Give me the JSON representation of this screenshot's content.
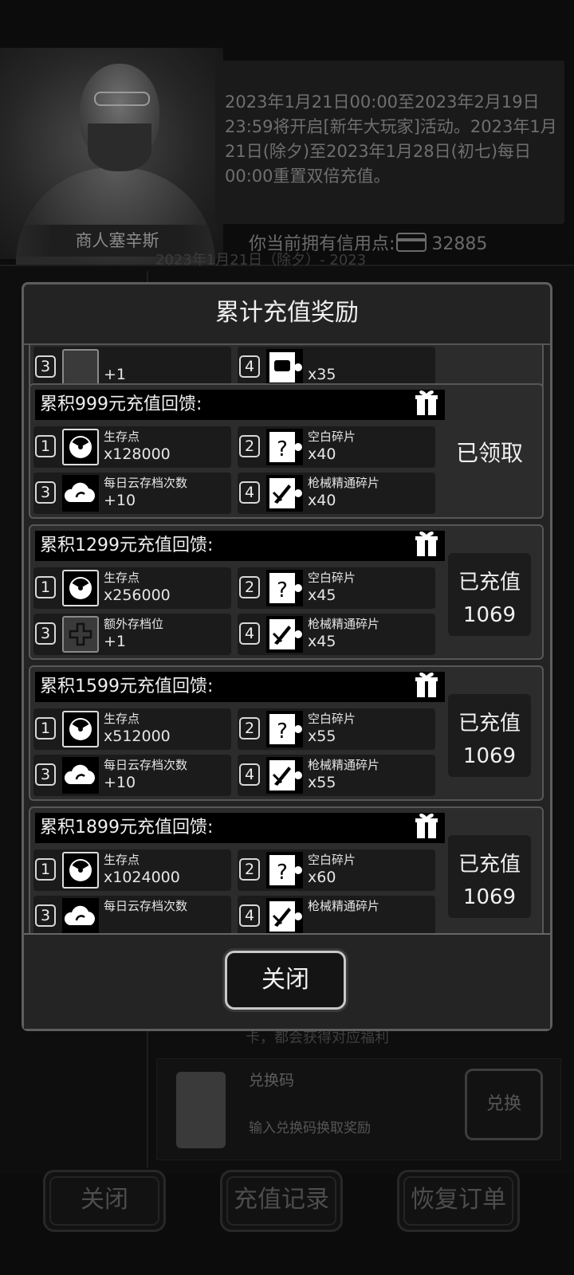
{
  "background": {
    "merchant_name": "商人塞辛斯",
    "announcement": "2023年1月21日00:00至2023年2月19日23:59将开启[新年大玩家]活动。2023年1月21日(除夕)至2023年1月28日(初七)每日00:00重置双倍充值。",
    "credits_label": "你当前拥有信用点:",
    "credits_value": "32885",
    "peek_row_text": "2023年1月21日（除夕）- 2023",
    "peek_card_text": "卡，都会获得对应福利",
    "redeem_code": {
      "title": "兑换码",
      "description": "输入兑换码换取奖励",
      "button": "兑换"
    },
    "bottom_buttons": {
      "close": "关闭",
      "records": "充值记录",
      "restore": "恢复订单"
    }
  },
  "dialog": {
    "title": "累计充值奖励",
    "close_button": "关闭",
    "partial_tier": {
      "items": [
        {
          "num": "3",
          "qty": "+1",
          "icon": "plus-slot-icon"
        },
        {
          "num": "4",
          "qty": "x35",
          "icon": "shield-fragment-icon"
        }
      ]
    },
    "tiers": [
      {
        "title": "累积999元充值回馈:",
        "status_type": "claimed",
        "status_line1": "已领取",
        "status_line2": "",
        "items": [
          {
            "num": "1",
            "name": "生存点",
            "qty": "x128000",
            "icon": "radiation-icon"
          },
          {
            "num": "2",
            "name": "空白碎片",
            "qty": "x40",
            "icon": "puzzle-question-icon"
          },
          {
            "num": "3",
            "name": "每日云存档次数",
            "qty": "+10",
            "icon": "cloud-sync-icon"
          },
          {
            "num": "4",
            "name": "枪械精通碎片",
            "qty": "x40",
            "icon": "gun-fragment-icon"
          }
        ]
      },
      {
        "title": "累积1299元充值回馈:",
        "status_type": "progress",
        "status_line1": "已充值",
        "status_line2": "1069",
        "items": [
          {
            "num": "1",
            "name": "生存点",
            "qty": "x256000",
            "icon": "radiation-icon"
          },
          {
            "num": "2",
            "name": "空白碎片",
            "qty": "x45",
            "icon": "puzzle-question-icon"
          },
          {
            "num": "3",
            "name": "额外存档位",
            "qty": "+1",
            "icon": "plus-slot-icon"
          },
          {
            "num": "4",
            "name": "枪械精通碎片",
            "qty": "x45",
            "icon": "gun-fragment-icon"
          }
        ]
      },
      {
        "title": "累积1599元充值回馈:",
        "status_type": "progress",
        "status_line1": "已充值",
        "status_line2": "1069",
        "items": [
          {
            "num": "1",
            "name": "生存点",
            "qty": "x512000",
            "icon": "radiation-icon"
          },
          {
            "num": "2",
            "name": "空白碎片",
            "qty": "x55",
            "icon": "puzzle-question-icon"
          },
          {
            "num": "3",
            "name": "每日云存档次数",
            "qty": "+10",
            "icon": "cloud-sync-icon"
          },
          {
            "num": "4",
            "name": "枪械精通碎片",
            "qty": "x55",
            "icon": "gun-fragment-icon"
          }
        ]
      },
      {
        "title": "累积1899元充值回馈:",
        "status_type": "progress",
        "status_line1": "已充值",
        "status_line2": "1069",
        "items": [
          {
            "num": "1",
            "name": "生存点",
            "qty": "x1024000",
            "icon": "radiation-icon"
          },
          {
            "num": "2",
            "name": "空白碎片",
            "qty": "x60",
            "icon": "puzzle-question-icon"
          },
          {
            "num": "3",
            "name": "每日云存档次数",
            "qty": "",
            "icon": "cloud-sync-icon"
          },
          {
            "num": "4",
            "name": "枪械精通碎片",
            "qty": "",
            "icon": "gun-fragment-icon"
          }
        ]
      }
    ]
  }
}
